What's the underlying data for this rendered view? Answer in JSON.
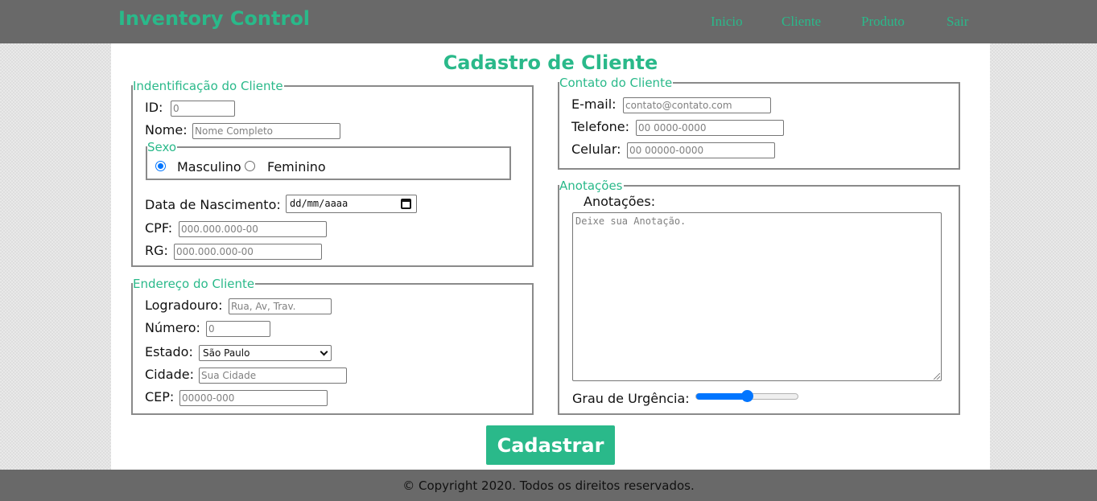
{
  "header": {
    "brand": "Inventory Control",
    "nav": [
      "Inicio",
      "Cliente",
      "Produto",
      "Sair"
    ]
  },
  "page_title": "Cadastro de Cliente",
  "identificacao": {
    "legend": "Indentificação do Cliente",
    "id_label": "ID:",
    "id_placeholder": "0",
    "nome_label": "Nome:",
    "nome_placeholder": "Nome Completo",
    "sexo": {
      "legend": "Sexo",
      "options": [
        "Masculino",
        "Feminino"
      ],
      "selected": "Masculino"
    },
    "nascimento_label": "Data de Nascimento:",
    "nascimento_value": "dd/mm/aaaa",
    "cpf_label": "CPF:",
    "cpf_placeholder": "000.000.000-00",
    "rg_label": "RG:",
    "rg_placeholder": "000.000.000-00"
  },
  "endereco": {
    "legend": "Endereço do Cliente",
    "logradouro_label": "Logradouro:",
    "logradouro_placeholder": "Rua, Av, Trav.",
    "numero_label": "Número:",
    "numero_placeholder": "0",
    "estado_label": "Estado:",
    "estado_value": "São Paulo",
    "cidade_label": "Cidade:",
    "cidade_placeholder": "Sua Cidade",
    "cep_label": "CEP:",
    "cep_placeholder": "00000-000"
  },
  "contato": {
    "legend": "Contato do Cliente",
    "email_label": "E-mail:",
    "email_placeholder": "contato@contato.com",
    "telefone_label": "Telefone:",
    "telefone_placeholder": "00 0000-0000",
    "celular_label": "Celular:",
    "celular_placeholder": "00 00000-0000"
  },
  "anotacoes": {
    "legend": "Anotações",
    "label": "Anotações:",
    "placeholder": "Deixe sua Anotação.",
    "urgencia_label": "Grau de Urgência:",
    "urgencia_level": 0.5
  },
  "submit_label": "Cadastrar",
  "footer": "© Copyright 2020. Todos os direitos reservados.",
  "colors": {
    "accent": "#2ab98a",
    "header_bg": "#696969",
    "control_blue": "#0075ff"
  }
}
